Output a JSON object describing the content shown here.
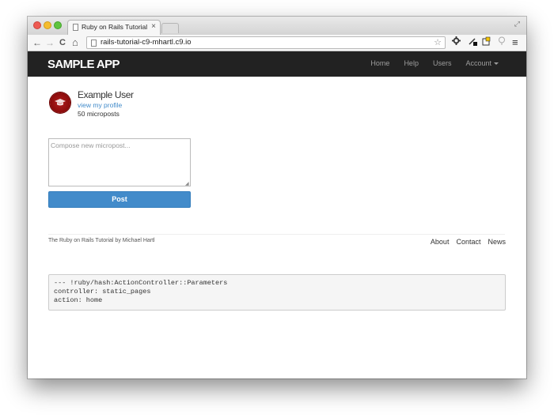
{
  "browser": {
    "tab_title": "Ruby on Rails Tutorial Sample App",
    "tab_close": "×",
    "url": "rails-tutorial-c9-mhartl.c9.io",
    "back_glyph": "←",
    "forward_glyph": "→",
    "reload_glyph": "C",
    "home_glyph": "⌂",
    "star_glyph": "☆",
    "menu_glyph": "≡",
    "expand_glyph": "⤢",
    "extensions": [
      "gear-icon",
      "tool-icon",
      "shield-icon",
      "lightbulb-icon"
    ]
  },
  "navbar": {
    "logo": "SAMPLE APP",
    "links": [
      "Home",
      "Help",
      "Users",
      "Account"
    ]
  },
  "user": {
    "name": "Example User",
    "profile_link": "view my profile",
    "micropost_count": "50 microposts"
  },
  "compose": {
    "placeholder": "Compose new micropost...",
    "submit": "Post"
  },
  "footer": {
    "credit": "The Ruby on Rails Tutorial by Michael Hartl",
    "links": [
      "About",
      "Contact",
      "News"
    ]
  },
  "debug": {
    "text": "--- !ruby/hash:ActionController::Parameters\ncontroller: static_pages\naction: home"
  },
  "colors": {
    "navbar_bg": "#222222",
    "accent": "#428bca",
    "avatar": "#8a0b0b"
  }
}
